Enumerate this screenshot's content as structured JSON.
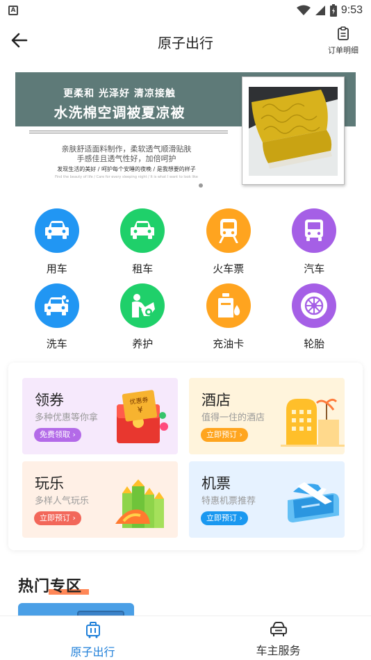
{
  "status_bar": {
    "time": "9:53",
    "app_badge": "A"
  },
  "header": {
    "title": "原子出行",
    "orders_label": "订单明细"
  },
  "banner": {
    "slogan": "更柔和  光泽好  清凉接触",
    "title": "水洗棉空调被夏凉被",
    "desc_line1": "亲肤舒适面料制作，柔软透气顺滑贴肤",
    "desc_line2": "手感佳且透气性好，加倍呵护",
    "tagline": "发现生活的美好 / 呵护每个安睡的夜晚 / 是我想要的样子",
    "tiny_text": "Find the beauty of life / Care for every sleeping night / It is what I want to look like"
  },
  "icon_grid": [
    {
      "label": "用车",
      "icon": "car-icon",
      "color": "#2196f3"
    },
    {
      "label": "租车",
      "icon": "rent-car-icon",
      "color": "#1fd06a"
    },
    {
      "label": "火车票",
      "icon": "train-icon",
      "color": "#ffa41f"
    },
    {
      "label": "汽车",
      "icon": "bus-icon",
      "color": "#a55fe6"
    },
    {
      "label": "洗车",
      "icon": "car-wash-icon",
      "color": "#2196f3"
    },
    {
      "label": "养护",
      "icon": "maintenance-icon",
      "color": "#1fd06a"
    },
    {
      "label": "充油卡",
      "icon": "fuel-card-icon",
      "color": "#ffa41f"
    },
    {
      "label": "轮胎",
      "icon": "tire-icon",
      "color": "#a55fe6"
    }
  ],
  "services": {
    "coupon": {
      "title": "领券",
      "subtitle": "多种优惠等你拿",
      "button": "免费领取 ›",
      "art_label": "优惠券",
      "currency": "¥"
    },
    "hotel": {
      "title": "酒店",
      "subtitle": "值得一住的酒店",
      "button": "立即预订 ›"
    },
    "fun": {
      "title": "玩乐",
      "subtitle": "多样人气玩乐",
      "button": "立即预订 ›"
    },
    "flight": {
      "title": "机票",
      "subtitle": "特惠机票推荐",
      "button": "立即预订 ›"
    }
  },
  "hot_zone": {
    "title": "热门专区"
  },
  "tab_bar": [
    {
      "label": "原子出行",
      "active": true,
      "color": "#1e7fd9"
    },
    {
      "label": "车主服务",
      "active": false,
      "color": "#333333"
    }
  ]
}
